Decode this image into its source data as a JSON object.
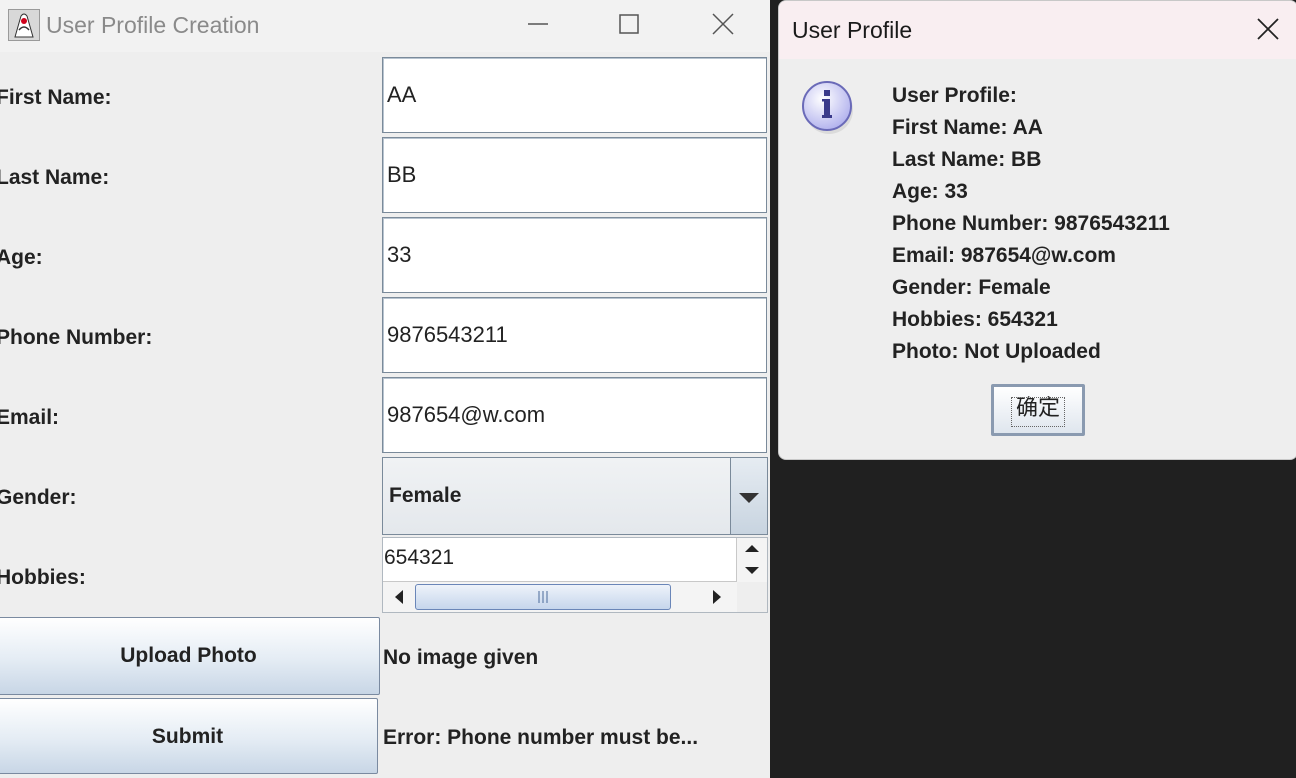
{
  "window": {
    "title": "User Profile Creation"
  },
  "form": {
    "first_name": {
      "label": "First Name:",
      "value": "AA"
    },
    "last_name": {
      "label": "Last Name:",
      "value": "BB"
    },
    "age": {
      "label": "Age:",
      "value": "33"
    },
    "phone": {
      "label": "Phone Number:",
      "value": "9876543211"
    },
    "email": {
      "label": "Email:",
      "value": "987654@w.com"
    },
    "gender": {
      "label": "Gender:",
      "value": "Female"
    },
    "hobbies": {
      "label": "Hobbies:",
      "value": "654321"
    },
    "upload_button": "Upload Photo",
    "photo_status": "No image given",
    "submit_button": "Submit",
    "error_status": "Error: Phone number must be..."
  },
  "dialog": {
    "title": "User Profile",
    "lines": [
      "User Profile:",
      "First Name: AA",
      "Last Name: BB",
      "Age: 33",
      "Phone Number: 9876543211",
      "Email: 987654@w.com",
      "Gender: Female",
      "Hobbies: 654321",
      "Photo: Not Uploaded"
    ],
    "ok_button": "确定"
  },
  "icons": {
    "app": "java-duke-icon",
    "info": "info-icon",
    "minimize": "minimize-icon",
    "maximize": "maximize-icon",
    "close": "close-icon"
  },
  "colors": {
    "window_bg": "#eeeeee",
    "desktop_bg": "#202020",
    "dialog_titlebar": "#f9eef1",
    "button_border": "#7a8aa0",
    "scroll_thumb": "#c6d6ec"
  }
}
